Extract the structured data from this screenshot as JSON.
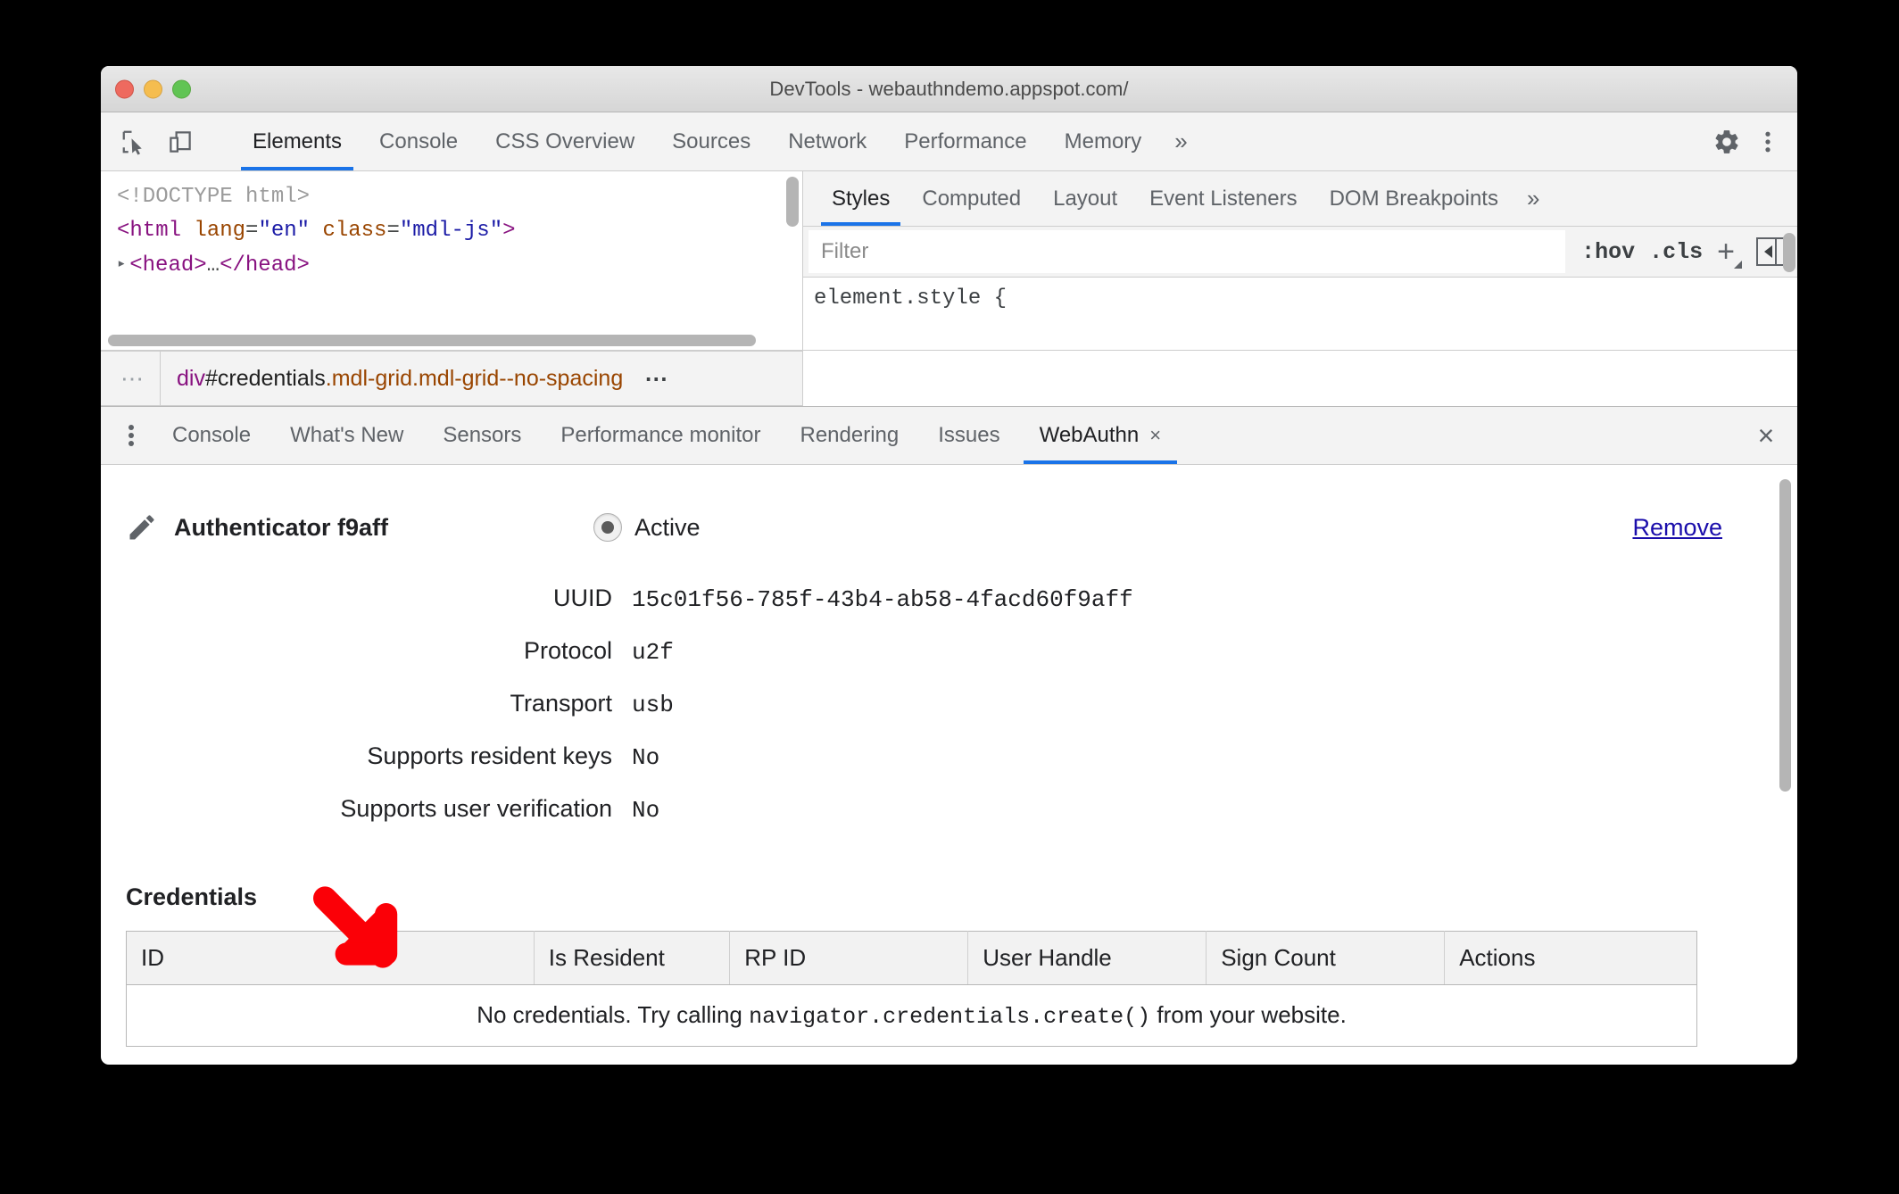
{
  "window": {
    "title": "DevTools - webauthndemo.appspot.com/"
  },
  "main_toolbar": {
    "inspect_icon": "inspect-cursor-icon",
    "device_icon": "device-toolbar-icon",
    "tabs": [
      {
        "label": "Elements",
        "active": true
      },
      {
        "label": "Console",
        "active": false
      },
      {
        "label": "CSS Overview",
        "active": false
      },
      {
        "label": "Sources",
        "active": false
      },
      {
        "label": "Network",
        "active": false
      },
      {
        "label": "Performance",
        "active": false
      },
      {
        "label": "Memory",
        "active": false
      }
    ],
    "more_label": "»",
    "settings_icon": "gear-icon",
    "menu_icon": "kebab-menu-icon"
  },
  "elements_pane": {
    "dom": {
      "doctype": "<!DOCTYPE html>",
      "html_open": "<html ",
      "attr_lang_name": "lang",
      "attr_lang_eq": "=",
      "attr_lang_value": "\"en\"",
      "attr_class_name": " class",
      "attr_class_eq": "=",
      "attr_class_value": "\"mdl-js\"",
      "html_close_bracket": ">",
      "head_line_open": "<head>",
      "head_line_ellipsis": "…",
      "head_line_close": "</head>"
    },
    "breadcrumb": {
      "left_ellipsis": "⋯",
      "tag": "div",
      "id": "#credentials",
      "classes": ".mdl-grid.mdl-grid--no-spacing",
      "right_ellipsis": "⋯"
    }
  },
  "styles_pane": {
    "tabs": [
      {
        "label": "Styles",
        "active": true
      },
      {
        "label": "Computed",
        "active": false
      },
      {
        "label": "Layout",
        "active": false
      },
      {
        "label": "Event Listeners",
        "active": false
      },
      {
        "label": "DOM Breakpoints",
        "active": false
      }
    ],
    "more_label": "»",
    "filter": {
      "value": "",
      "placeholder": "Filter"
    },
    "actions": {
      "hov_label": ":hov",
      "cls_label": ".cls",
      "new_rule_icon": "plus-icon",
      "sidebar_toggle_icon": "toggle-sidebar-icon"
    },
    "rule": "element.style {"
  },
  "drawer": {
    "menu_icon": "kebab-menu-icon",
    "tabs": [
      {
        "label": "Console",
        "active": false
      },
      {
        "label": "What's New",
        "active": false
      },
      {
        "label": "Sensors",
        "active": false
      },
      {
        "label": "Performance monitor",
        "active": false
      },
      {
        "label": "Rendering",
        "active": false
      },
      {
        "label": "Issues",
        "active": false
      },
      {
        "label": "WebAuthn",
        "active": true,
        "closable": true
      }
    ],
    "tab_close_label": "×",
    "close_drawer_label": "×"
  },
  "webauthn": {
    "authenticator_title": "Authenticator f9aff",
    "edit_icon": "pencil-icon",
    "state": {
      "label": "Active",
      "selected": true
    },
    "remove_label": "Remove",
    "fields": [
      {
        "label": "UUID",
        "value": "15c01f56-785f-43b4-ab58-4facd60f9aff"
      },
      {
        "label": "Protocol",
        "value": "u2f"
      },
      {
        "label": "Transport",
        "value": "usb"
      },
      {
        "label": "Supports resident keys",
        "value": "No"
      },
      {
        "label": "Supports user verification",
        "value": "No"
      }
    ],
    "credentials": {
      "heading": "Credentials",
      "columns": [
        "ID",
        "Is Resident",
        "RP ID",
        "User Handle",
        "Sign Count",
        "Actions"
      ],
      "rows": [],
      "empty_prefix": "No credentials. Try calling ",
      "empty_code": "navigator.credentials.create()",
      "empty_suffix": " from your website."
    }
  },
  "annotation": {
    "arrow_color": "#fb0007",
    "arrow_name": "red-pointer-arrow"
  }
}
